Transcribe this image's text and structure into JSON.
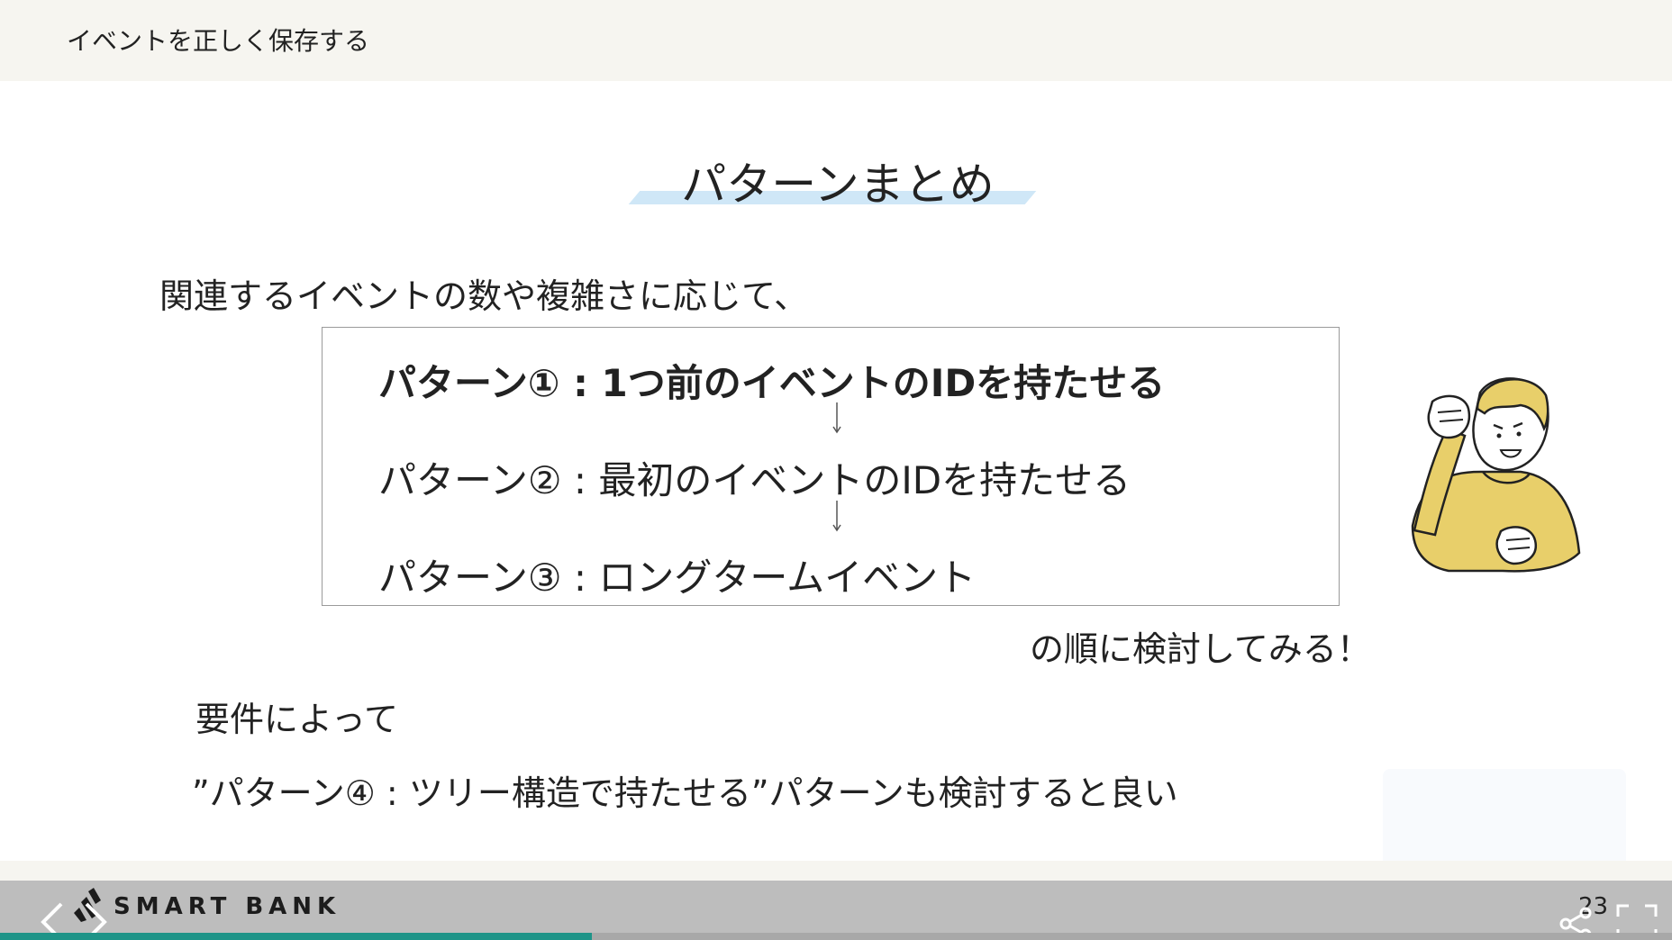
{
  "header": {
    "title": "イベントを正しく保存する"
  },
  "slide": {
    "title": "パターンまとめ",
    "intro": "関連するイベントの数や複雑さに応じて、",
    "patterns": [
      "パターン① : 1つ前のイベントのIDを持たせる",
      "パターン② : 最初のイベントのIDを持たせる",
      "パターン③ : ロングタームイベント"
    ],
    "conclusion": "の順に検討してみる！",
    "requirement_line1": "要件によって",
    "requirement_line2": "”パターン④ : ツリー構造で持たせる”パターンも検討すると良い"
  },
  "footer": {
    "logo_text": "SMART BANK",
    "page_number": "23",
    "progress": 0.354
  },
  "colors": {
    "header_bg": "#f6f5f0",
    "title_highlight": "#cfe7f7",
    "footer_bg": "#bdbdbd",
    "progress_fill": "#1e9488",
    "illustration_shirt": "#e8cf6a"
  },
  "icons": {
    "prev": "chevron-left-icon",
    "next": "chevron-right-icon",
    "share": "share-icon",
    "fullscreen": "fullscreen-icon",
    "arrow": "arrow-down-icon"
  }
}
